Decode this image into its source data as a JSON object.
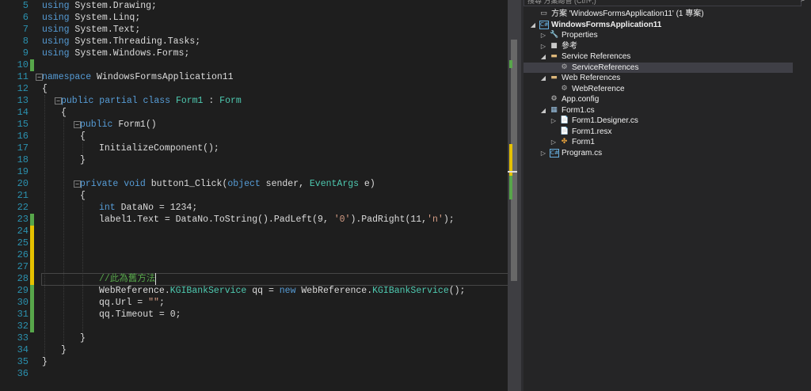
{
  "editor": {
    "lines": [
      {
        "n": "5",
        "indent": 0,
        "tokens": [
          [
            "kw",
            "using"
          ],
          [
            "pl",
            " System.Drawing;"
          ]
        ]
      },
      {
        "n": "6",
        "indent": 0,
        "tokens": [
          [
            "kw",
            "using"
          ],
          [
            "pl",
            " System.Linq;"
          ]
        ]
      },
      {
        "n": "7",
        "indent": 0,
        "tokens": [
          [
            "kw",
            "using"
          ],
          [
            "pl",
            " System.Text;"
          ]
        ]
      },
      {
        "n": "8",
        "indent": 0,
        "tokens": [
          [
            "kw",
            "using"
          ],
          [
            "pl",
            " System.Threading.Tasks;"
          ]
        ]
      },
      {
        "n": "9",
        "indent": 0,
        "tokens": [
          [
            "kw",
            "using"
          ],
          [
            "pl",
            " System.Windows.Forms;"
          ]
        ]
      },
      {
        "n": "10",
        "indent": 0,
        "tokens": [],
        "change": "saved"
      },
      {
        "n": "11",
        "indent": 0,
        "tokens": [
          [
            "kw",
            "namespace"
          ],
          [
            "pl",
            " WindowsFormsApplication11"
          ]
        ],
        "fold": "−"
      },
      {
        "n": "12",
        "indent": 0,
        "tokens": [
          [
            "pl",
            "{"
          ]
        ]
      },
      {
        "n": "13",
        "indent": 1,
        "tokens": [
          [
            "kw",
            "public partial class"
          ],
          [
            "pl",
            " "
          ],
          [
            "ty",
            "Form1"
          ],
          [
            "pl",
            " : "
          ],
          [
            "ty",
            "Form"
          ]
        ],
        "fold": "−"
      },
      {
        "n": "14",
        "indent": 1,
        "tokens": [
          [
            "pl",
            "{"
          ]
        ]
      },
      {
        "n": "15",
        "indent": 2,
        "tokens": [
          [
            "kw",
            "public"
          ],
          [
            "pl",
            " Form1()"
          ]
        ],
        "fold": "−"
      },
      {
        "n": "16",
        "indent": 2,
        "tokens": [
          [
            "pl",
            "{"
          ]
        ]
      },
      {
        "n": "17",
        "indent": 3,
        "tokens": [
          [
            "pl",
            "InitializeComponent();"
          ]
        ]
      },
      {
        "n": "18",
        "indent": 2,
        "tokens": [
          [
            "pl",
            "}"
          ]
        ]
      },
      {
        "n": "19",
        "indent": 0,
        "tokens": []
      },
      {
        "n": "20",
        "indent": 2,
        "tokens": [
          [
            "kw",
            "private void"
          ],
          [
            "pl",
            " button1_Click("
          ],
          [
            "kw",
            "object"
          ],
          [
            "pl",
            " sender, "
          ],
          [
            "ty",
            "EventArgs"
          ],
          [
            "pl",
            " e)"
          ]
        ],
        "fold": "−"
      },
      {
        "n": "21",
        "indent": 2,
        "tokens": [
          [
            "pl",
            "{"
          ]
        ]
      },
      {
        "n": "22",
        "indent": 3,
        "tokens": [
          [
            "kw",
            "int"
          ],
          [
            "pl",
            " DataNo = 1234;"
          ]
        ]
      },
      {
        "n": "23",
        "indent": 3,
        "tokens": [
          [
            "pl",
            "label1.Text = DataNo.ToString().PadLeft(9, "
          ],
          [
            "str",
            "'0'"
          ],
          [
            "pl",
            ").PadRight(11,"
          ],
          [
            "str",
            "'n'"
          ],
          [
            "pl",
            ");"
          ]
        ],
        "change": "saved"
      },
      {
        "n": "24",
        "indent": 0,
        "tokens": [],
        "change": "unsaved"
      },
      {
        "n": "25",
        "indent": 0,
        "tokens": [],
        "change": "unsaved"
      },
      {
        "n": "26",
        "indent": 0,
        "tokens": [],
        "change": "unsaved"
      },
      {
        "n": "27",
        "indent": 0,
        "tokens": [],
        "change": "unsaved"
      },
      {
        "n": "28",
        "indent": 3,
        "tokens": [
          [
            "cm",
            "//此為舊方法"
          ]
        ],
        "change": "unsaved",
        "current": true
      },
      {
        "n": "29",
        "indent": 3,
        "tokens": [
          [
            "pl",
            "WebReference."
          ],
          [
            "ty",
            "KGIBankService"
          ],
          [
            "pl",
            " qq = "
          ],
          [
            "kw",
            "new"
          ],
          [
            "pl",
            " WebReference."
          ],
          [
            "ty",
            "KGIBankService"
          ],
          [
            "pl",
            "();"
          ]
        ],
        "change": "saved"
      },
      {
        "n": "30",
        "indent": 3,
        "tokens": [
          [
            "pl",
            "qq.Url = "
          ],
          [
            "str",
            "\"\""
          ],
          [
            "pl",
            ";"
          ]
        ],
        "change": "saved"
      },
      {
        "n": "31",
        "indent": 3,
        "tokens": [
          [
            "pl",
            "qq.Timeout = 0;"
          ]
        ],
        "change": "saved"
      },
      {
        "n": "32",
        "indent": 0,
        "tokens": [],
        "change": "saved"
      },
      {
        "n": "33",
        "indent": 2,
        "tokens": [
          [
            "pl",
            "}"
          ]
        ]
      },
      {
        "n": "34",
        "indent": 1,
        "tokens": [
          [
            "pl",
            "}"
          ]
        ]
      },
      {
        "n": "35",
        "indent": 0,
        "tokens": [
          [
            "pl",
            "}"
          ]
        ]
      },
      {
        "n": "36",
        "indent": 0,
        "tokens": []
      }
    ]
  },
  "explorer": {
    "search_placeholder": "搜尋 方案總管 (Ctrl+;)",
    "items": [
      {
        "label": "方案 'WindowsFormsApplication11' (1 專案)",
        "level": 0,
        "arrow": "",
        "icon": "solution-icon",
        "glyph": "▭",
        "color": "#c8c8c8"
      },
      {
        "label": "WindowsFormsApplication11",
        "level": 0,
        "arrow": "◢",
        "icon": "csharp-project-icon",
        "glyph": "C#",
        "color": "#68b0e0",
        "bold": true
      },
      {
        "label": "Properties",
        "level": 1,
        "arrow": "▷",
        "icon": "wrench-icon",
        "glyph": "🔧",
        "color": "#c8c8c8"
      },
      {
        "label": "參考",
        "level": 1,
        "arrow": "▷",
        "icon": "references-icon",
        "glyph": "■",
        "color": "#c8c8c8"
      },
      {
        "label": "Service References",
        "level": 1,
        "arrow": "◢",
        "icon": "folder-icon",
        "glyph": "▬",
        "color": "#dcb67a"
      },
      {
        "label": "ServiceReferences",
        "level": 2,
        "arrow": "",
        "icon": "service-reference-icon",
        "glyph": "⚙",
        "color": "#b4b4b4",
        "selected": true
      },
      {
        "label": "Web References",
        "level": 1,
        "arrow": "◢",
        "icon": "folder-icon",
        "glyph": "▬",
        "color": "#dcb67a"
      },
      {
        "label": "WebReference",
        "level": 2,
        "arrow": "",
        "icon": "web-reference-icon",
        "glyph": "⚙",
        "color": "#b4b4b4"
      },
      {
        "label": "App.config",
        "level": 1,
        "arrow": "",
        "icon": "config-file-icon",
        "glyph": "⚙",
        "color": "#c8c8c8"
      },
      {
        "label": "Form1.cs",
        "level": 1,
        "arrow": "◢",
        "icon": "form-icon",
        "glyph": "▦",
        "color": "#9cc4e4"
      },
      {
        "label": "Form1.Designer.cs",
        "level": 2,
        "arrow": "▷",
        "icon": "csharp-file-icon",
        "glyph": "📄",
        "color": "#68b0e0"
      },
      {
        "label": "Form1.resx",
        "level": 2,
        "arrow": "",
        "icon": "resx-file-icon",
        "glyph": "📄",
        "color": "#c8c8c8"
      },
      {
        "label": "Form1",
        "level": 2,
        "arrow": "▷",
        "icon": "class-icon",
        "glyph": "✤",
        "color": "#e8a23c"
      },
      {
        "label": "Program.cs",
        "level": 1,
        "arrow": "▷",
        "icon": "csharp-file-icon",
        "glyph": "C#",
        "color": "#68b0e0"
      }
    ]
  },
  "colors": {
    "saved": "#57a64a",
    "unsaved": "#e5c100"
  }
}
